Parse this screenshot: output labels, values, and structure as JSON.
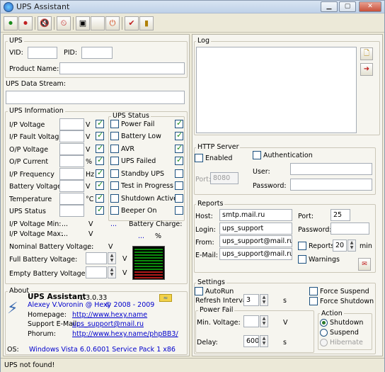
{
  "window": {
    "title": "UPS Assistant"
  },
  "toolbar": {
    "icons": [
      "connect-icon",
      "disconnect-icon",
      "mute-icon",
      "clock-icon",
      "device-icon",
      "blank-icon",
      "power-icon",
      "check-icon",
      "exit-icon"
    ]
  },
  "ups": {
    "group": "UPS",
    "vid_label": "VID:",
    "pid_label": "PID:",
    "vid": "",
    "pid": "",
    "product_label": "Product Name:",
    "product": ""
  },
  "stream": {
    "label": "UPS Data Stream:",
    "value": ""
  },
  "info": {
    "group": "UPS Information",
    "rows": [
      {
        "label": "I/P Voltage",
        "unit": "V"
      },
      {
        "label": "I/P Fault Voltage",
        "unit": "V"
      },
      {
        "label": "O/P Voltage",
        "unit": "V"
      },
      {
        "label": "O/P Current",
        "unit": "%"
      },
      {
        "label": "I/P Frequency",
        "unit": "Hz"
      },
      {
        "label": "Battery Voltage",
        "unit": "V"
      },
      {
        "label": "Temperature",
        "unit": "°C"
      },
      {
        "label": "UPS Status",
        "unit": ""
      }
    ],
    "vmin_label": "I/P Voltage Min:",
    "vmin_value": "...",
    "vmin_unit": "V",
    "vmax_label": "I/P Voltage Max:",
    "vmax_value": "...",
    "vmax_unit": "V",
    "charge_label": "Battery Charge:",
    "charge_dots1": "...",
    "charge_dots2": "...",
    "charge_unit": "%",
    "nominal_label": "Nominal Battery Voltage:",
    "nominal_value": "...",
    "nominal_unit": "V",
    "full_label": "Full Battery Voltage:",
    "full_unit": "V",
    "empty_label": "Empty Battery Voltage:",
    "empty_unit": "V"
  },
  "status": {
    "group": "UPS Status",
    "items": [
      "Power Fail",
      "Battery Low",
      "AVR",
      "UPS Failed",
      "Standby UPS",
      "Test in Progress",
      "Shutdown Active",
      "Beeper On"
    ],
    "checked": [
      true,
      true,
      true,
      true,
      false,
      false,
      false,
      false
    ]
  },
  "about": {
    "group": "About",
    "app": "UPS Assistant",
    "version": "1.3.0.33",
    "author": "Alexey V.Voronin @ Hexy",
    "copyright": "© 2008 - 2009",
    "homepage_label": "Homepage:",
    "homepage": "http://www.hexy.name",
    "email_label": "Support E-Mail:",
    "email": "ups_support@mail.ru",
    "phorum_label": "Phorum:",
    "phorum": "http://www.hexy.name/phpBB3/",
    "os_label": "OS:",
    "os": "Windows Vista 6.0.6001 Service Pack 1 x86"
  },
  "log": {
    "group": "Log",
    "text": ""
  },
  "http": {
    "group": "HTTP Server",
    "enabled_label": "Enabled",
    "auth_label": "Authentication",
    "port_label": "Port:",
    "port": "8080",
    "user_label": "User:",
    "user": "",
    "password_label": "Password:",
    "password": ""
  },
  "reports": {
    "group": "Reports",
    "host_label": "Host:",
    "host": "smtp.mail.ru",
    "port_label": "Port:",
    "port": "25",
    "login_label": "Login:",
    "login": "ups_support",
    "password_label": "Password:",
    "password": "",
    "from_label": "From:",
    "from": "ups_support@mail.ru",
    "email_label": "E-Mail:",
    "email": "ups_support@mail.ru",
    "reports_label": "Reports",
    "reports_value": "20",
    "reports_unit": "min",
    "warnings_label": "Warnings"
  },
  "settings": {
    "group": "Settings",
    "autorun_label": "AutoRun",
    "refresh_label": "Refresh Interval:",
    "refresh_value": "3",
    "refresh_unit": "s",
    "force_suspend": "Force Suspend",
    "force_shutdown": "Force Shutdown",
    "powerfail_group": "Power Fail",
    "minv_label": "Min. Voltage:",
    "minv_value": "",
    "minv_unit": "V",
    "delay_label": "Delay:",
    "delay_value": "600",
    "delay_unit": "s",
    "action_group": "Action",
    "shutdown": "Shutdown",
    "suspend": "Suspend",
    "hibernate": "Hibernate"
  },
  "statusbar": {
    "text": "UPS not found!"
  }
}
